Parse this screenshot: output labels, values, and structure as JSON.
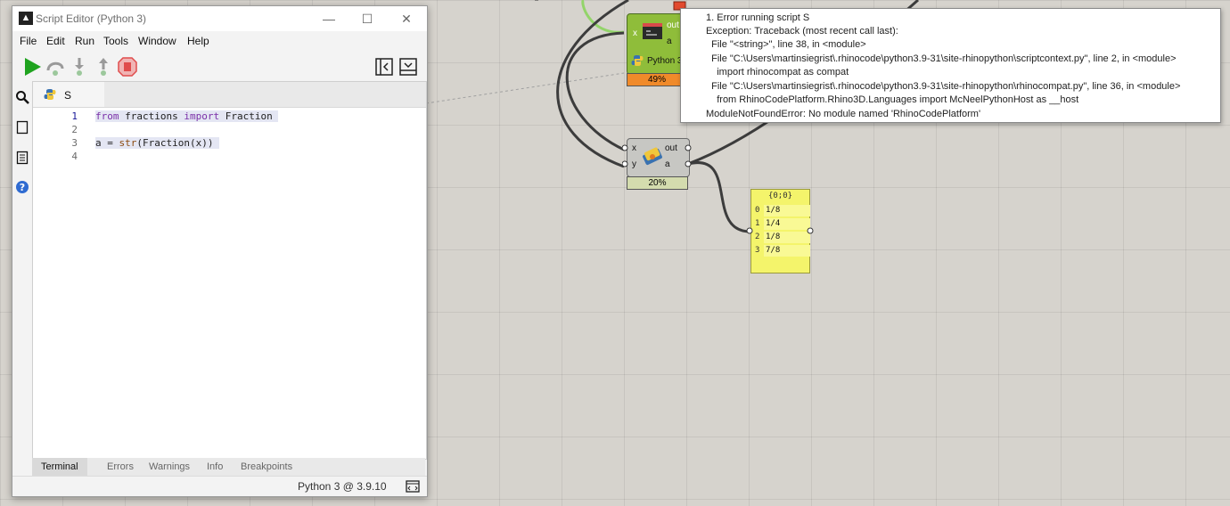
{
  "window": {
    "title": "Script Editor (Python 3)",
    "app_icon": "rhino-icon"
  },
  "menu": [
    "File",
    "Edit",
    "Run",
    "Tools",
    "Window",
    "Help"
  ],
  "toolbar": {
    "run": "play-icon",
    "step_over": "step-over-icon",
    "step_in": "step-in-icon",
    "step_out": "step-out-icon",
    "stop": "stop-icon",
    "collapse_panel": "panel-left-icon",
    "toggle_terminal": "panel-bottom-icon"
  },
  "sidebar": [
    "search-icon",
    "explorer-icon",
    "document-icon",
    "help-icon"
  ],
  "doc_tab": {
    "icon": "python-icon",
    "label": "S"
  },
  "code": [
    {
      "num": "1",
      "text": "from fractions import Fraction "
    },
    {
      "num": "2",
      "text": ""
    },
    {
      "num": "3",
      "text": "a = str(Fraction(x)) "
    },
    {
      "num": "4",
      "text": ""
    }
  ],
  "bottom_tabs": [
    "Terminal",
    "Errors",
    "Warnings",
    "Info",
    "Breakpoints"
  ],
  "status": {
    "version": "Python 3 @ 3.9.10"
  },
  "components": {
    "python_error": {
      "out": "out",
      "a": "a",
      "label": "Python 3",
      "progress": "49%",
      "x": "x"
    },
    "python_ok": {
      "x": "x",
      "y": "y",
      "out": "out",
      "a": "a",
      "progress": "20%"
    }
  },
  "panel": {
    "header": "{0;0}",
    "rows": [
      {
        "idx": "0",
        "val": "1/8"
      },
      {
        "idx": "1",
        "val": "1/4"
      },
      {
        "idx": "2",
        "val": "1/8"
      },
      {
        "idx": "3",
        "val": "7/8"
      }
    ]
  },
  "error_tooltip": {
    "lines": [
      "1. Error running script S",
      "Exception: Traceback (most recent call last):",
      "  File \"<string>\", line 38, in <module>",
      "  File \"C:\\Users\\martinsiegrist\\.rhinocode\\python3.9-31\\site-rhinopython\\scriptcontext.py\", line 2, in <module>",
      "    import rhinocompat as compat",
      "  File \"C:\\Users\\martinsiegrist\\.rhinocode\\python3.9-31\\site-rhinopython\\rhinocompat.py\", line 36, in <module>",
      "    from RhinoCodePlatform.Rhino3D.Languages import McNeelPythonHost as __host",
      "ModuleNotFoundError: No module named 'RhinoCodePlatform'"
    ]
  },
  "colors": {
    "canvas": "#d6d3cd",
    "wire_green": "#8fd35b",
    "panel": "#f4f46b",
    "run_green": "#1fa31f",
    "stop_red": "#e04c4c"
  }
}
